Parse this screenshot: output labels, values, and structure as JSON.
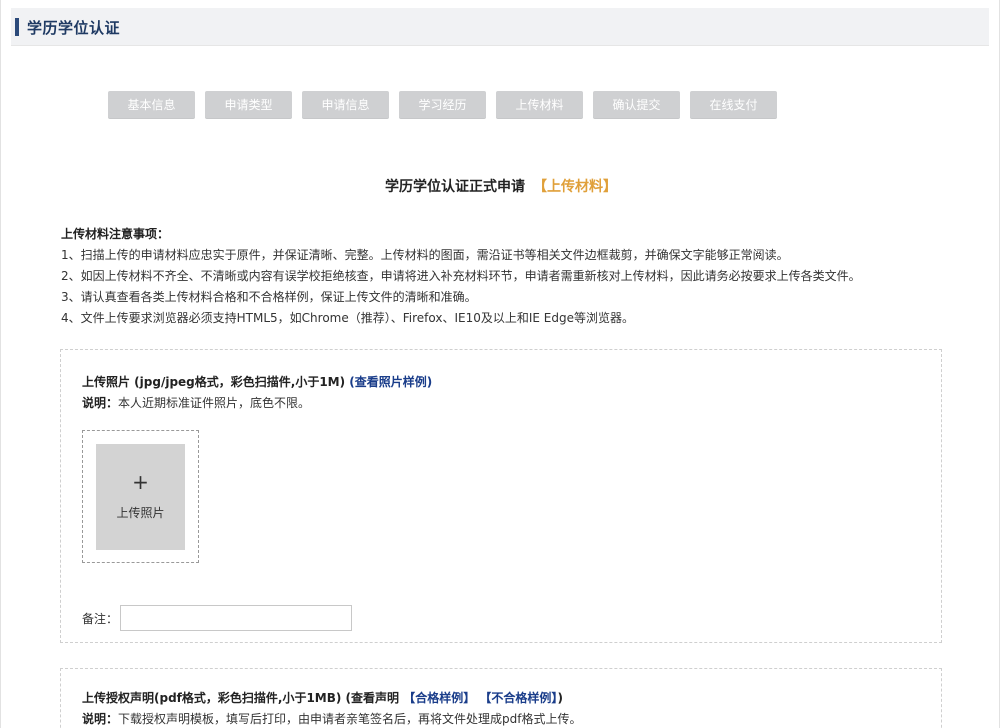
{
  "header": {
    "title": "学历学位认证"
  },
  "steps": [
    "基本信息",
    "申请类型",
    "申请信息",
    "学习经历",
    "上传材料",
    "确认提交",
    "在线支付"
  ],
  "main": {
    "title": "学历学位认证正式申请",
    "highlight": "【上传材料】"
  },
  "notice": {
    "title": "上传材料注意事项：",
    "items": [
      "1、扫描上传的申请材料应忠实于原件，并保证清晰、完整。上传材料的图面，需沿证书等相关文件边框裁剪，并确保文字能够正常阅读。",
      "2、如因上传材料不齐全、不清晰或内容有误学校拒绝核查，申请将进入补充材料环节，申请者需重新核对上传材料，因此请务必按要求上传各类文件。",
      "3、请认真查看各类上传材料合格和不合格样例，保证上传文件的清晰和准确。",
      "4、文件上传要求浏览器必须支持HTML5，如Chrome（推荐）、Firefox、IE10及以上和IE Edge等浏览器。"
    ]
  },
  "photo_upload": {
    "title": "上传照片 (jpg/jpeg格式，彩色扫描件,小于1M)",
    "link": "(查看照片样例)",
    "desc_label": "说明：",
    "desc": "本人近期标准证件照片，底色不限。",
    "plus": "+",
    "button_label": "上传照片",
    "remark_label": "备注：",
    "remark_value": ""
  },
  "auth_upload": {
    "title": "上传授权声明(pdf格式，彩色扫描件,小于1MB) (查看声明",
    "link_ok": "【合格样例】",
    "link_bad": "【不合格样例】",
    "title_end": ")",
    "desc_label": "说明：",
    "desc": "下载授权声明模板，填写后打印，由申请者亲笔签名后，再将文件处理成pdf格式上传。"
  }
}
